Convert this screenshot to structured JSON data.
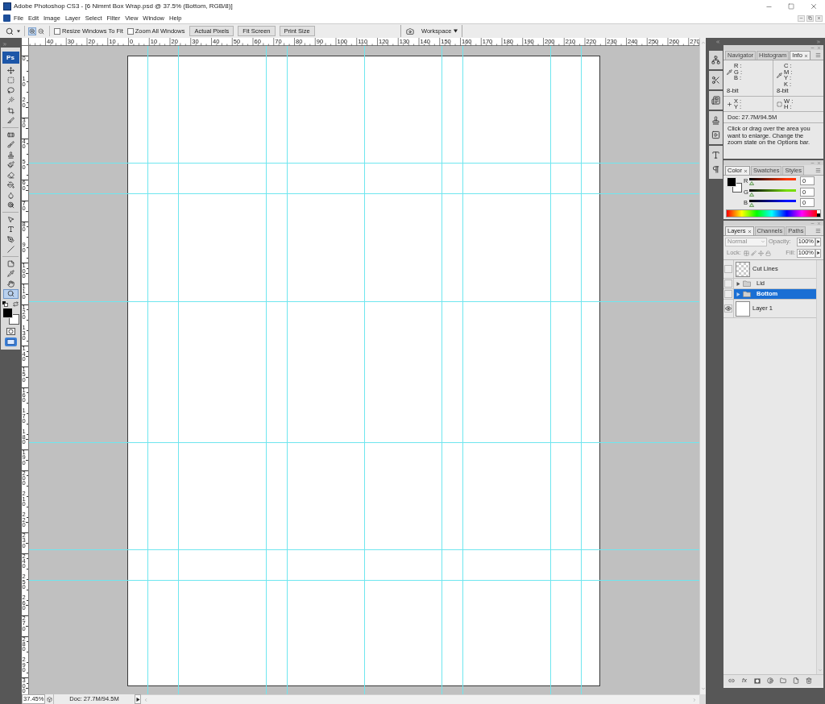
{
  "window": {
    "title": "Adobe Photoshop CS3 - [6 Nimmt Box Wrap.psd @ 37.5% (Bottom, RGB/8)]"
  },
  "menu": [
    "File",
    "Edit",
    "Image",
    "Layer",
    "Select",
    "Filter",
    "View",
    "Window",
    "Help"
  ],
  "options_bar": {
    "zoom_modes": [
      {
        "kind": "zoom_in",
        "selected": true
      },
      {
        "kind": "zoom_out",
        "selected": false
      }
    ],
    "checkboxes": [
      {
        "label": "Resize Windows To Fit",
        "checked": false
      },
      {
        "label": "Zoom All Windows",
        "checked": false
      }
    ],
    "buttons": [
      "Actual Pixels",
      "Fit Screen",
      "Print Size"
    ],
    "workspace": "Workspace"
  },
  "toolbox": {
    "logo": "Ps",
    "tool_groups": [
      [
        {
          "kind": "move",
          "selected": false
        },
        {
          "kind": "marquee",
          "selected": false
        },
        {
          "kind": "lasso",
          "selected": false
        },
        {
          "kind": "wand",
          "selected": false
        },
        {
          "kind": "crop",
          "selected": false
        },
        {
          "kind": "slice",
          "selected": false
        }
      ],
      [
        {
          "kind": "healing",
          "selected": false
        },
        {
          "kind": "brush",
          "selected": false
        },
        {
          "kind": "stamp",
          "selected": false
        },
        {
          "kind": "history_brush",
          "selected": false
        },
        {
          "kind": "eraser",
          "selected": false
        },
        {
          "kind": "bucket",
          "selected": false
        },
        {
          "kind": "blur",
          "selected": false
        },
        {
          "kind": "dodge",
          "selected": false
        }
      ],
      [
        {
          "kind": "path_select",
          "selected": false
        },
        {
          "kind": "type",
          "selected": false
        },
        {
          "kind": "pen",
          "selected": false
        },
        {
          "kind": "line",
          "selected": false
        }
      ],
      [
        {
          "kind": "notes",
          "selected": false
        },
        {
          "kind": "eyedropper",
          "selected": false
        },
        {
          "kind": "hand",
          "selected": false
        },
        {
          "kind": "zoom",
          "selected": true
        }
      ]
    ],
    "swatches": [
      {
        "kind": "foreground",
        "color": "#000000"
      },
      {
        "kind": "background",
        "color": "#ffffff"
      }
    ]
  },
  "rulers": {
    "horizontal": [
      "40",
      "30",
      "20",
      "10",
      "0",
      "10",
      "20",
      "30",
      "40",
      "50",
      "60",
      "70",
      "80",
      "90",
      "100",
      "110",
      "120",
      "130",
      "140",
      "150",
      "160",
      "170",
      "180",
      "190",
      "200",
      "210",
      "220",
      "230",
      "240",
      "250",
      "260",
      "270"
    ],
    "vertical": [
      "0",
      "10",
      "20",
      "30",
      "40",
      "50",
      "60",
      "70",
      "80",
      "90",
      "100",
      "110",
      "120",
      "130",
      "140",
      "150",
      "160",
      "170",
      "180",
      "190",
      "200",
      "210",
      "220",
      "230",
      "240",
      "250",
      "260",
      "270",
      "280",
      "290",
      "300"
    ]
  },
  "status_bar": {
    "zoom": "37.45%",
    "doc": "Doc: 27.7M/94.5M"
  },
  "info_panel": {
    "tabs": [
      {
        "label": "Navigator",
        "selected": false
      },
      {
        "label": "Histogram",
        "selected": false
      },
      {
        "label": "Info",
        "selected": true
      }
    ],
    "color_readouts": [
      {
        "labels": [
          "R :",
          "G :",
          "B :"
        ],
        "depth": "8-bit"
      },
      {
        "labels": [
          "C :",
          "M :",
          "Y :",
          "K :"
        ],
        "depth": "8-bit"
      }
    ],
    "size_readouts": [
      {
        "kind": "position",
        "labels": [
          "X :",
          "Y :"
        ]
      },
      {
        "kind": "size",
        "labels": [
          "W :",
          "H :"
        ]
      }
    ],
    "doc": "Doc: 27.7M/94.5M",
    "hint": "Click or drag over the area you want to enlarge. Change the zoom state on the Options bar."
  },
  "color_panel": {
    "tabs": [
      {
        "label": "Color",
        "selected": true
      },
      {
        "label": "Swatches",
        "selected": false
      },
      {
        "label": "Styles",
        "selected": false
      }
    ],
    "swatches": [
      {
        "kind": "foreground",
        "color": "#000000"
      },
      {
        "kind": "background",
        "color": "#ffffff"
      }
    ],
    "channels": [
      {
        "name": "R",
        "color": "#ff3300",
        "value": "0",
        "level": 0
      },
      {
        "name": "G",
        "color": "#77dd00",
        "value": "0",
        "level": 0
      },
      {
        "name": "B",
        "color": "#0011ff",
        "value": "0",
        "level": 0
      }
    ]
  },
  "layers_panel": {
    "tabs": [
      {
        "label": "Layers",
        "selected": true
      },
      {
        "label": "Channels",
        "selected": false
      },
      {
        "label": "Paths",
        "selected": false
      }
    ],
    "blend_mode": "Normal",
    "opacity_label": "Opacity:",
    "opacity": "100%",
    "lock_label": "Lock:",
    "fill_label": "Fill:",
    "fill": "100%",
    "options_disabled": true,
    "layers": [
      {
        "name": "Cut Lines",
        "kind": "layer",
        "transparent": true,
        "visible": false,
        "selected": false
      },
      {
        "name": "Lid",
        "kind": "group",
        "expanded": false,
        "visible": false,
        "selected": false
      },
      {
        "name": "Bottom",
        "kind": "group",
        "expanded": false,
        "visible": false,
        "selected": true
      },
      {
        "name": "Layer 1",
        "kind": "layer",
        "transparent": false,
        "visible": true,
        "selected": false
      }
    ],
    "style_button": "fx"
  }
}
